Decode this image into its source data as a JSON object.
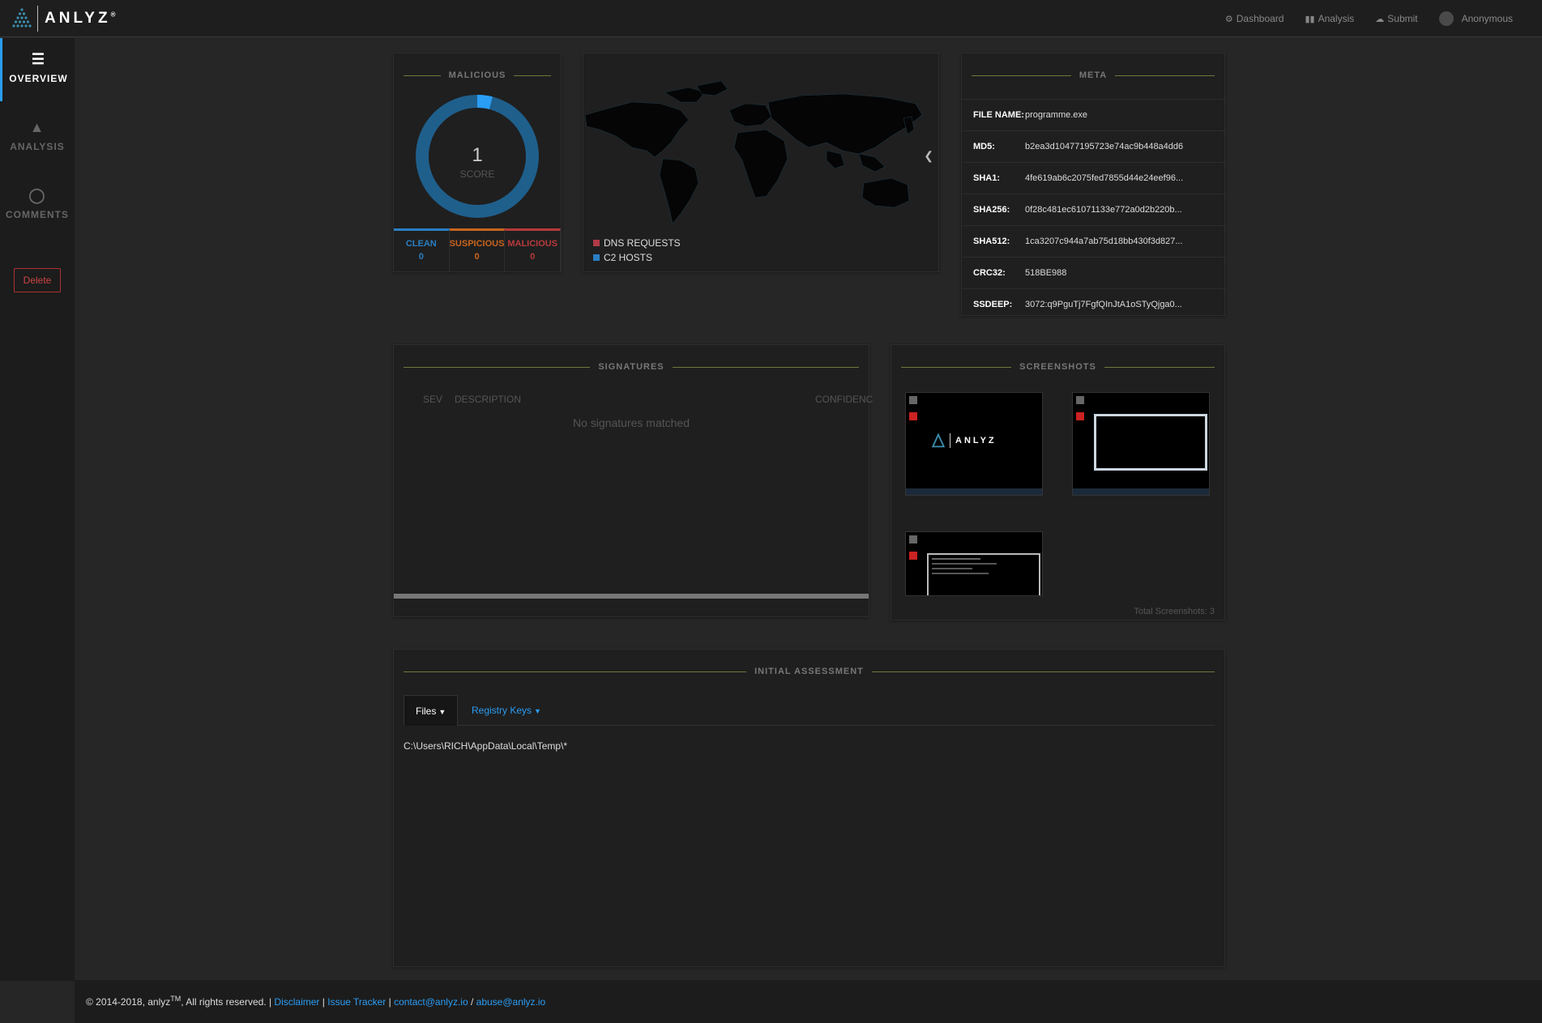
{
  "app": {
    "name": "ANLYZ",
    "reg": "®"
  },
  "nav": {
    "dashboard": "Dashboard",
    "analysis": "Analysis",
    "submit": "Submit",
    "user": "Anonymous"
  },
  "sidebar": {
    "overview": "OVERVIEW",
    "analysis": "ANALYSIS",
    "comments": "COMMENTS",
    "delete": "Delete"
  },
  "malicious": {
    "title": "MALICIOUS",
    "score": "1",
    "score_label": "SCORE",
    "score_fraction": 0.04,
    "stats": [
      {
        "label": "CLEAN",
        "value": "0",
        "color": "#2a7fc4"
      },
      {
        "label": "SUSPICIOUS",
        "value": "0",
        "color": "#c8641e"
      },
      {
        "label": "MALICIOUS",
        "value": "0",
        "color": "#b83a3a"
      }
    ]
  },
  "map": {
    "legend": [
      {
        "label": "DNS REQUESTS",
        "color": "#b23a48"
      },
      {
        "label": "C2 HOSTS",
        "color": "#2a7fc4"
      }
    ]
  },
  "meta": {
    "title": "META",
    "rows": [
      {
        "key": "FILE NAME:",
        "value": "programme.exe"
      },
      {
        "key": "MD5:",
        "value": "b2ea3d10477195723e74ac9b448a4dd6"
      },
      {
        "key": "SHA1:",
        "value": "4fe619ab6c2075fed7855d44e24eef96..."
      },
      {
        "key": "SHA256:",
        "value": "0f28c481ec61071133e772a0d2b220b..."
      },
      {
        "key": "SHA512:",
        "value": "1ca3207c944a7ab75d18bb430f3d827..."
      },
      {
        "key": "CRC32:",
        "value": "518BE988"
      },
      {
        "key": "SSDEEP:",
        "value": "3072:q9PguTj7FgfQInJtA1oSTyQjga0..."
      }
    ]
  },
  "signatures": {
    "title": "SIGNATURES",
    "col_sev": "SEV",
    "col_desc": "DESCRIPTION",
    "col_conf": "CONFIDENC",
    "empty": "No signatures matched"
  },
  "screenshots": {
    "title": "SCREENSHOTS",
    "total": "Total Screenshots: 3",
    "thumb_logo": "ANLYZ"
  },
  "assessment": {
    "title": "INITIAL ASSESSMENT",
    "tabs": [
      "Files",
      "Registry Keys"
    ],
    "path": "C:\\Users\\RICH\\AppData\\Local\\Temp\\*"
  },
  "footer": {
    "copyright": "© 2014-2018, anlyz",
    "tm": "TM",
    "rights": ", All rights reserved. | ",
    "disclaimer": "Disclaimer",
    "sep1": " | ",
    "issue": "Issue Tracker",
    "sep2": " | ",
    "contact": "contact@anlyz.io",
    "slash": " / ",
    "abuse": "abuse@anlyz.io"
  }
}
